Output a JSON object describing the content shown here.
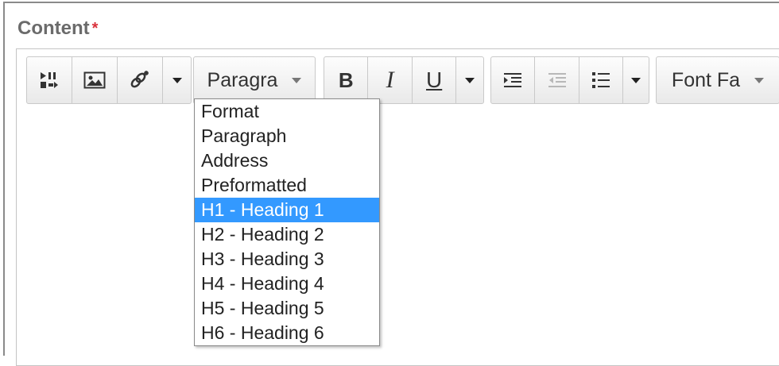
{
  "field": {
    "label": "Content",
    "required_mark": "*"
  },
  "toolbar": {
    "group1": {
      "icons": [
        "media-toggle-icon",
        "image-icon",
        "link-icon"
      ]
    },
    "block_format": {
      "value": "Paragra"
    },
    "group3": {
      "bold": "B",
      "italic": "I",
      "underline": "U"
    },
    "group4": {
      "icons": [
        "indent-icon",
        "outdent-icon",
        "bullet-list-icon"
      ]
    },
    "font_family": {
      "value": "Font Fa"
    }
  },
  "dropdown": {
    "items": [
      "Format",
      "Paragraph",
      "Address",
      "Preformatted",
      "H1 - Heading 1",
      "H2 - Heading 2",
      "H3 - Heading 3",
      "H4 - Heading 4",
      "H5 - Heading 5",
      "H6 - Heading 6"
    ],
    "selected": "H1 - Heading 1"
  },
  "colors": {
    "selection": "#3399ff",
    "required": "#d9303a",
    "label": "#6b6b6b"
  }
}
